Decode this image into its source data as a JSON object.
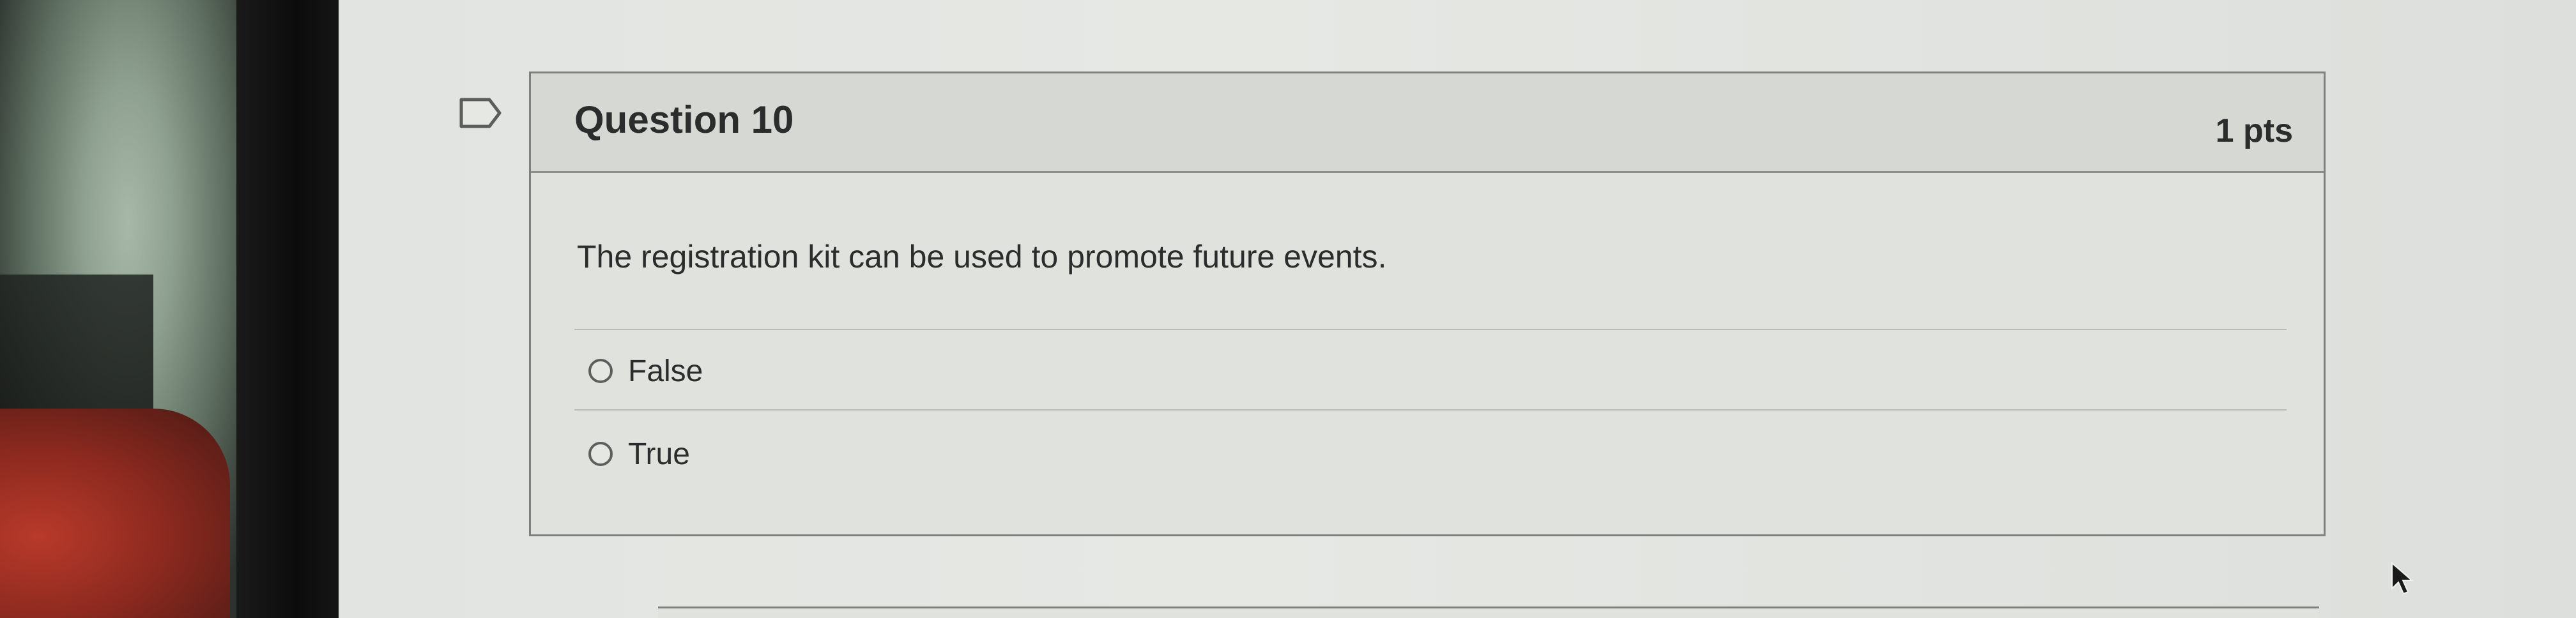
{
  "question": {
    "title": "Question 10",
    "points": "1 pts",
    "text": "The registration kit can be used to promote future events."
  },
  "answers": [
    {
      "label": "False",
      "selected": false
    },
    {
      "label": "True",
      "selected": false
    }
  ],
  "icons": {
    "flag": "bookmark-flag-icon",
    "cursor": "mouse-pointer-icon",
    "radio": "radio-unselected-icon"
  },
  "colors": {
    "page_bg": "#e2e4e1",
    "header_bg": "#d6d8d4",
    "text": "#2b2d2c",
    "border": "#7d807d"
  }
}
